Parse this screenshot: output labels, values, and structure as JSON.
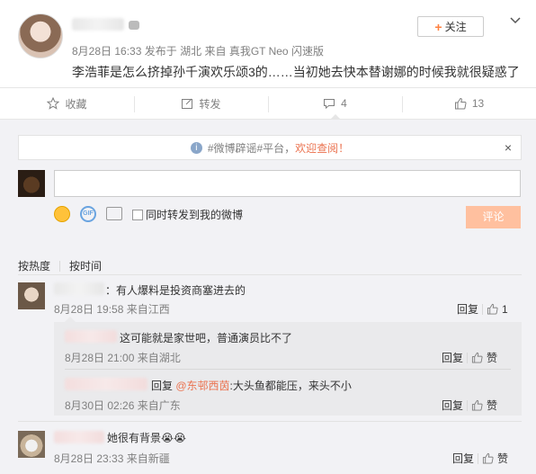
{
  "post": {
    "location": "湖北",
    "timestamp": "8月28日 16:33",
    "published_from": "发布于",
    "source_prefix": "来自",
    "source": "真我GT Neo 闪速版",
    "follow_label": "关注",
    "follow_plus": "+",
    "text": "李浩菲是怎么挤掉孙千演欢乐颂3的……当初她去快本替谢娜的时候我就很疑惑了"
  },
  "actions": {
    "favorite_label": "收藏",
    "repost_label": "转发",
    "comment_count": "4",
    "like_count": "13"
  },
  "notice": {
    "text": "#微博辟谣#平台，",
    "link": "欢迎查阅！",
    "close": "×"
  },
  "composer": {
    "input_value": "",
    "sync_label": "同时转发到我的微博",
    "submit_label": "评论"
  },
  "sort": {
    "hot_label": "按热度",
    "time_label": "按时间"
  },
  "comments": [
    {
      "text": "：有人爆料是投资商塞进去的",
      "time": "8月28日 19:58",
      "source": "来自江西",
      "reply_label": "回复",
      "like_count": "1",
      "replies": [
        {
          "text": "这可能就是家世吧，普通演员比不了",
          "time": "8月28日 21:00",
          "source": "来自湖北",
          "reply_label": "回复",
          "like_label": "赞"
        },
        {
          "reply_prefix": "回复",
          "mention": "@东邨西茵",
          "text": ":大头鱼都能压，来头不小",
          "time": "8月30日 02:26",
          "source": "来自广东",
          "reply_label": "回复",
          "like_label": "赞"
        }
      ]
    },
    {
      "text": "她很有背景",
      "emoji": "😭😭",
      "time": "8月28日 23:33",
      "source": "来自新疆",
      "reply_label": "回复",
      "like_label": "赞"
    }
  ],
  "colors": {
    "accent": "#ff8140",
    "link": "#eb7350",
    "submit_bg": "#ffc09f",
    "meta": "#808080"
  }
}
